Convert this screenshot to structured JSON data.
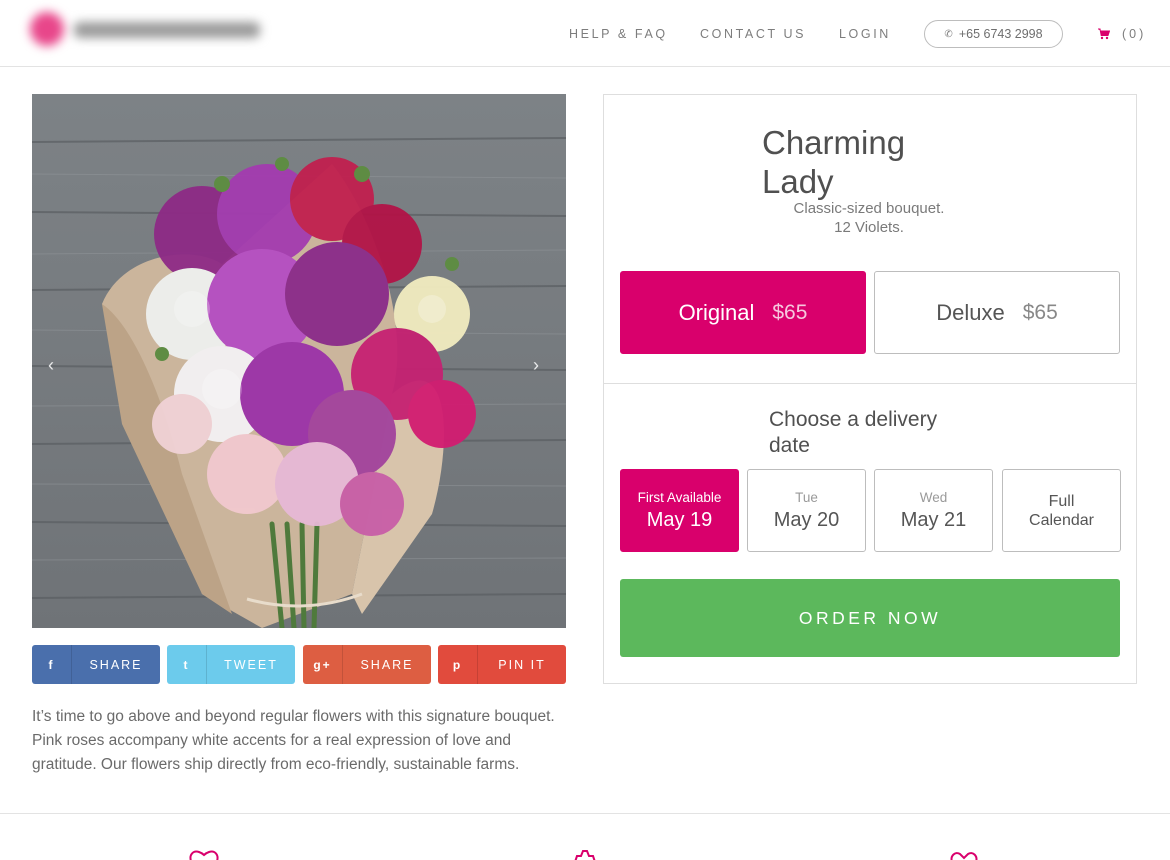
{
  "header": {
    "nav": {
      "help": "HELP & FAQ",
      "contact": "CONTACT US",
      "login": "LOGIN"
    },
    "phone": "+65 6743 2998",
    "cart_count": "(0)"
  },
  "gallery": {
    "prev_icon": "chevron-left-icon",
    "next_icon": "chevron-right-icon",
    "prev_glyph": "‹",
    "next_glyph": "›"
  },
  "share": [
    {
      "icon": "facebook-icon",
      "glyph": "f",
      "label": "SHARE",
      "color": "#4a6fac"
    },
    {
      "icon": "twitter-icon",
      "glyph": "t",
      "label": "TWEET",
      "color": "#6ccbec"
    },
    {
      "icon": "google-plus-icon",
      "glyph": "g+",
      "label": "SHARE",
      "color": "#dd5e42"
    },
    {
      "icon": "pinterest-icon",
      "glyph": "p",
      "label": "PIN IT",
      "color": "#e14b3d"
    }
  ],
  "description": "It’s time to go above and beyond regular flowers with this signature bouquet. Pink roses accompany white accents for a real expression of love and gratitude. Our flowers ship directly from eco-friendly, sustainable farms.",
  "product": {
    "title": "Charming Lady",
    "subtitle": "Classic-sized bouquet. 12 Violets.",
    "sizes": [
      {
        "name": "Original",
        "price": "$65",
        "selected": true
      },
      {
        "name": "Deluxe",
        "price": "$65",
        "selected": false
      }
    ]
  },
  "delivery": {
    "heading": "Choose a delivery date",
    "dates": [
      {
        "day": "First Available",
        "date": "May 19",
        "selected": true
      },
      {
        "day": "Tue",
        "date": "May 20",
        "selected": false
      },
      {
        "day": "Wed",
        "date": "May 21",
        "selected": false
      }
    ],
    "full_calendar": "Full Calendar"
  },
  "order_button": "ORDER NOW",
  "colors": {
    "accent": "#d9006c",
    "order": "#5cb85c"
  },
  "footer_icons": [
    "heart-outline-icon",
    "badge-icon",
    "heart-ribbon-icon"
  ]
}
